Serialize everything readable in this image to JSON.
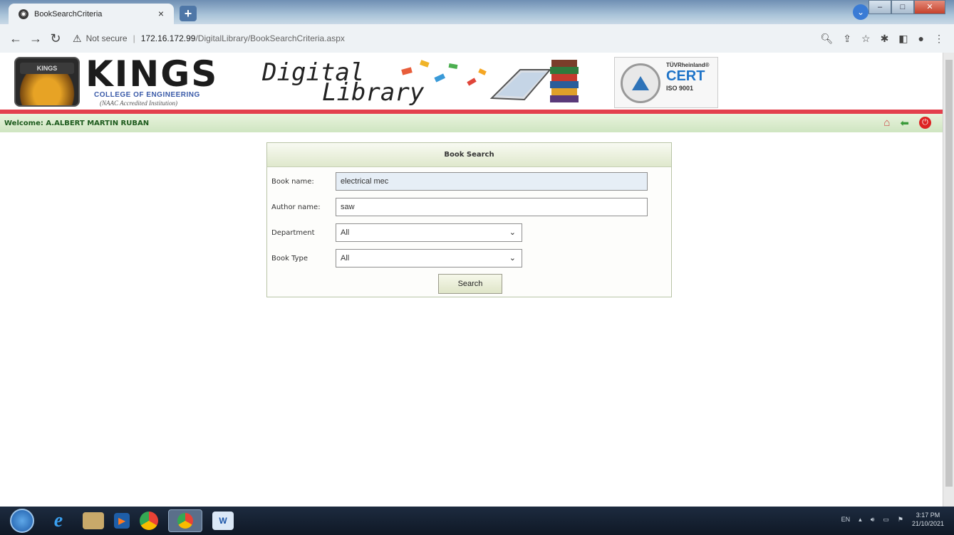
{
  "browser": {
    "tab_title": "BookSearchCriteria",
    "tab_close": "×",
    "new_tab": "+",
    "security_label": "Not secure",
    "url_host": "172.16.172.99",
    "url_path": "/DigitalLibrary/BookSearchCriteria.aspx"
  },
  "header": {
    "logo_tag": "KINGS",
    "college_name": "KINGS",
    "college_sub": "COLLEGE OF ENGINEERING",
    "accreditation": "(NAAC Accredited Institution)",
    "title_line1": "Digital",
    "title_line2": "Library",
    "cert_brand": "TÜVRheinland®",
    "cert_word": "CERT",
    "cert_iso": "ISO 9001"
  },
  "welcome": {
    "text": "Welcome: A.ALBERT MARTIN RUBAN"
  },
  "search_panel": {
    "title": "Book Search",
    "book_name_label": "Book name:",
    "book_name_value": "electrical mec",
    "author_name_label": "Author name:",
    "author_name_value": "saw",
    "department_label": "Department",
    "department_value": "All",
    "book_type_label": "Book Type",
    "book_type_value": "All",
    "search_button": "Search"
  },
  "taskbar": {
    "language": "EN",
    "time": "3:17 PM",
    "date": "21/10/2021"
  }
}
